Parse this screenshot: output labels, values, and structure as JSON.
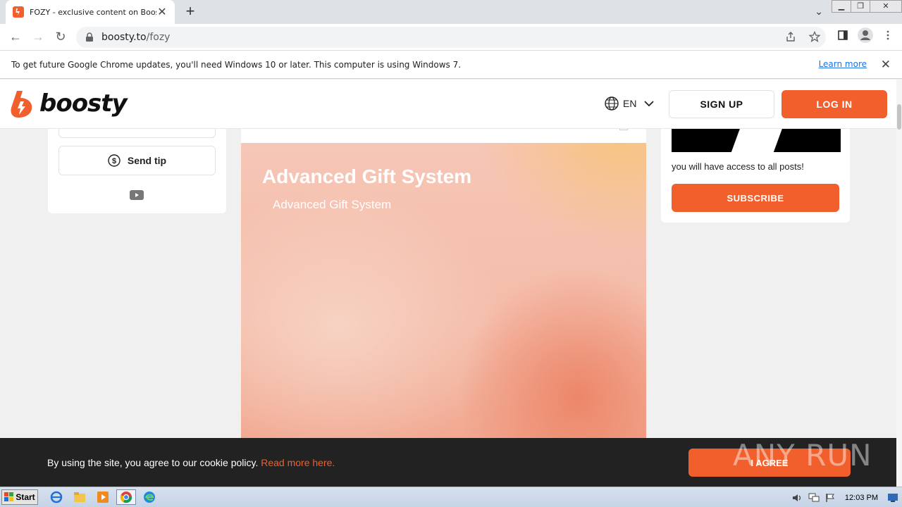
{
  "browser": {
    "tab_title": "FOZY - exclusive content on Boosty",
    "url_domain": "boosty.to",
    "url_path": "/fozy",
    "infobar_text": "To get future Google Chrome updates, you'll need Windows 10 or later. This computer is using Windows 7.",
    "infobar_link": "Learn more"
  },
  "header": {
    "logo_text": "boosty",
    "lang_label": "EN",
    "signup_label": "SIGN UP",
    "login_label": "LOG IN"
  },
  "left_card": {
    "tip_label": "Send tip"
  },
  "post": {
    "title": "Advanced Gift System",
    "subtitle": "Advanced Gift System"
  },
  "right_card": {
    "access_text": "you will have access to all posts!",
    "subscribe_label": "SUBSCRIBE"
  },
  "cookie": {
    "text": "By using the site, you agree to our cookie policy.",
    "link": "Read more here.",
    "agree_label": "I AGREE",
    "watermark": "ANY RUN"
  },
  "taskbar": {
    "start_label": "Start",
    "clock": "12:03 PM"
  },
  "colors": {
    "brand": "#f15f2c",
    "cookie_bg": "#222222"
  }
}
